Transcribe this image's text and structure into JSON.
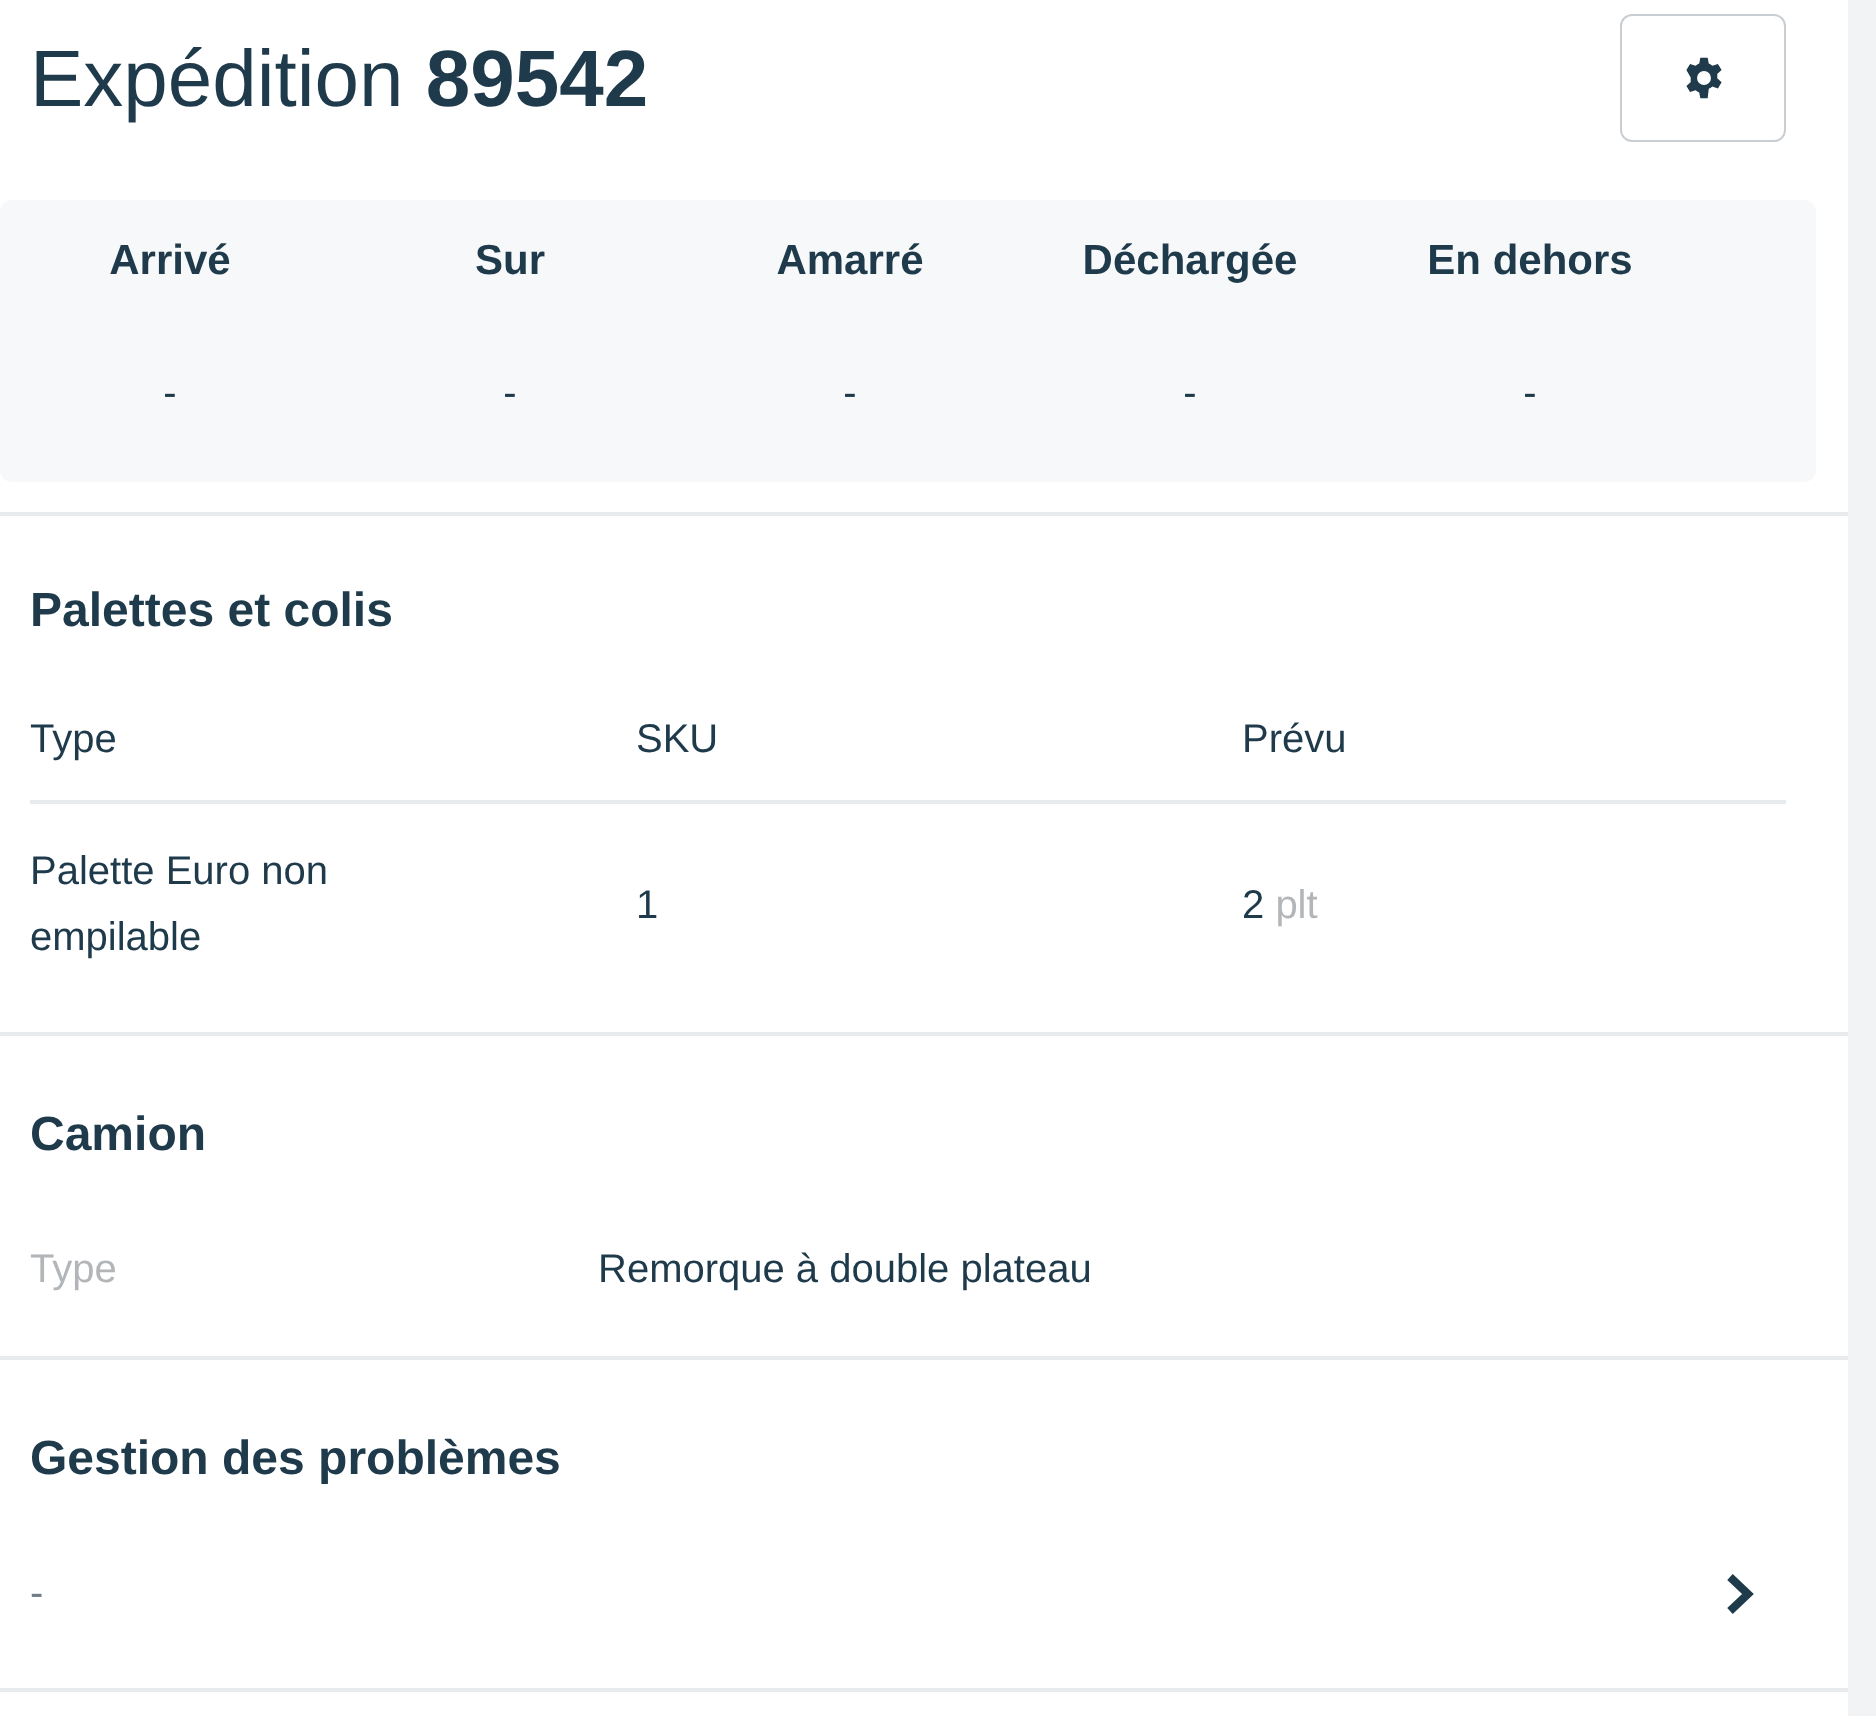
{
  "header": {
    "title": "Expédition **89542**"
  },
  "status": [
    {
      "label": "Arrivé",
      "value": "-"
    },
    {
      "label": "Sur",
      "value": "-"
    },
    {
      "label": "Amarré",
      "value": "-"
    },
    {
      "label": "Déchargée",
      "value": "-"
    },
    {
      "label": "En dehors",
      "value": "-"
    }
  ],
  "pallets": {
    "title": "Palettes et colis",
    "columns": [
      "Type",
      "SKU",
      "Prévu"
    ],
    "rows": [
      {
        "type": "Palette Euro non empilable",
        "sku": "1",
        "planned": "2",
        "unit": "plt"
      }
    ]
  },
  "truck": {
    "title": "Camion",
    "fields": [
      {
        "label": "Type",
        "value": "Remorque à double plateau"
      }
    ]
  },
  "issues": {
    "title": "Gestion des problèmes",
    "value": "-"
  }
}
